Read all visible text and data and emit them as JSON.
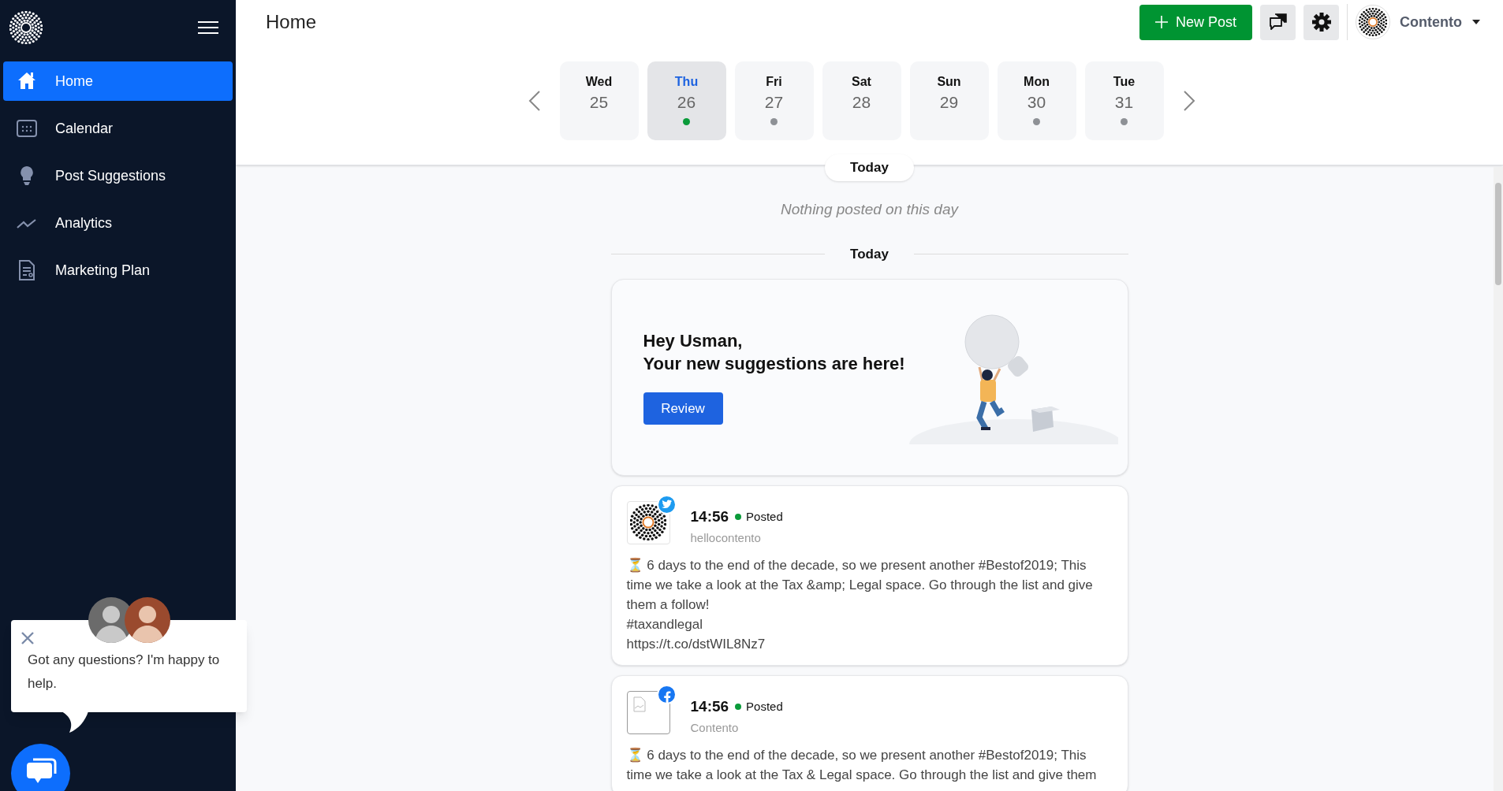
{
  "sidebar": {
    "items": [
      {
        "label": "Home",
        "selected": true
      },
      {
        "label": "Calendar",
        "selected": false
      },
      {
        "label": "Post Suggestions",
        "selected": false
      },
      {
        "label": "Analytics",
        "selected": false
      },
      {
        "label": "Marketing Plan",
        "selected": false
      }
    ]
  },
  "header": {
    "title": "Home",
    "new_post": "New Post",
    "account": "Contento"
  },
  "days": [
    {
      "day": "Wed",
      "date": "25",
      "selected": false
    },
    {
      "day": "Thu",
      "date": "26",
      "selected": true,
      "color": "#0a9b3a"
    },
    {
      "day": "Fri",
      "date": "27",
      "selected": false,
      "color": "#8e9196"
    },
    {
      "day": "Sat",
      "date": "28",
      "selected": false
    },
    {
      "day": "Sun",
      "date": "29",
      "selected": false
    },
    {
      "day": "Mon",
      "date": "30",
      "selected": false,
      "color": "#8e9196"
    },
    {
      "day": "Tue",
      "date": "31",
      "selected": false,
      "color": "#8e9196"
    }
  ],
  "feed": {
    "sticky_label": "Today",
    "empty_note": "Nothing posted on this day",
    "divider_label": "Today",
    "suggestion_card": {
      "lines": [
        "Hey Usman,",
        "Your new suggestions are here!"
      ],
      "button": "Review"
    },
    "posts": [
      {
        "kind": "twitter",
        "time": "14:56",
        "status": "Posted",
        "account": "hellocontento",
        "paragraphs": [
          "⏳ 6 days to the end of the decade, so we present another #Bestof2019; This time we take a look at the Tax &amp; Legal space. Go through the list and give them a follow!",
          "#taxandlegal",
          "https://t.co/dstWIL8Nz7"
        ]
      },
      {
        "kind": "facebook",
        "time": "14:56",
        "status": "Posted",
        "account": "Contento",
        "paragraphs": [
          "⏳ 6 days to the end of the decade, so we present another #Bestof2019; This time we take a look at the Tax & Legal space. Go through the list and give them"
        ]
      }
    ]
  },
  "chat": {
    "message": "Got any questions? I'm happy to help."
  }
}
